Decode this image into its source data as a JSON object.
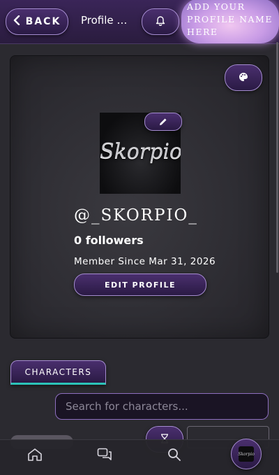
{
  "header": {
    "back_label": "BACK",
    "title": "Profile of...",
    "name_banner": "ADD YOUR PROFILE NAME HERE"
  },
  "profile": {
    "avatar_logo_text": "Skorpio",
    "username": "@_SKORPIO_",
    "followers": "0 followers",
    "member_since": "Member Since Mar 31, 2026",
    "edit_profile_label": "EDIT PROFILE"
  },
  "tabs": {
    "characters_label": "CHARACTERS"
  },
  "search": {
    "placeholder": "Search for characters..."
  },
  "icons": {
    "back": "chevron-left-icon",
    "bell": "bell-icon",
    "palette": "palette-icon",
    "edit": "pencil-icon",
    "filter": "hourglass-filter-icon",
    "home": "home-icon",
    "chat": "chat-icon",
    "search": "search-icon"
  },
  "colors": {
    "accent": "#4a2f6e",
    "border": "#a58cd0",
    "tab_underline": "#2cc3b8",
    "background": "#2b2a30"
  }
}
